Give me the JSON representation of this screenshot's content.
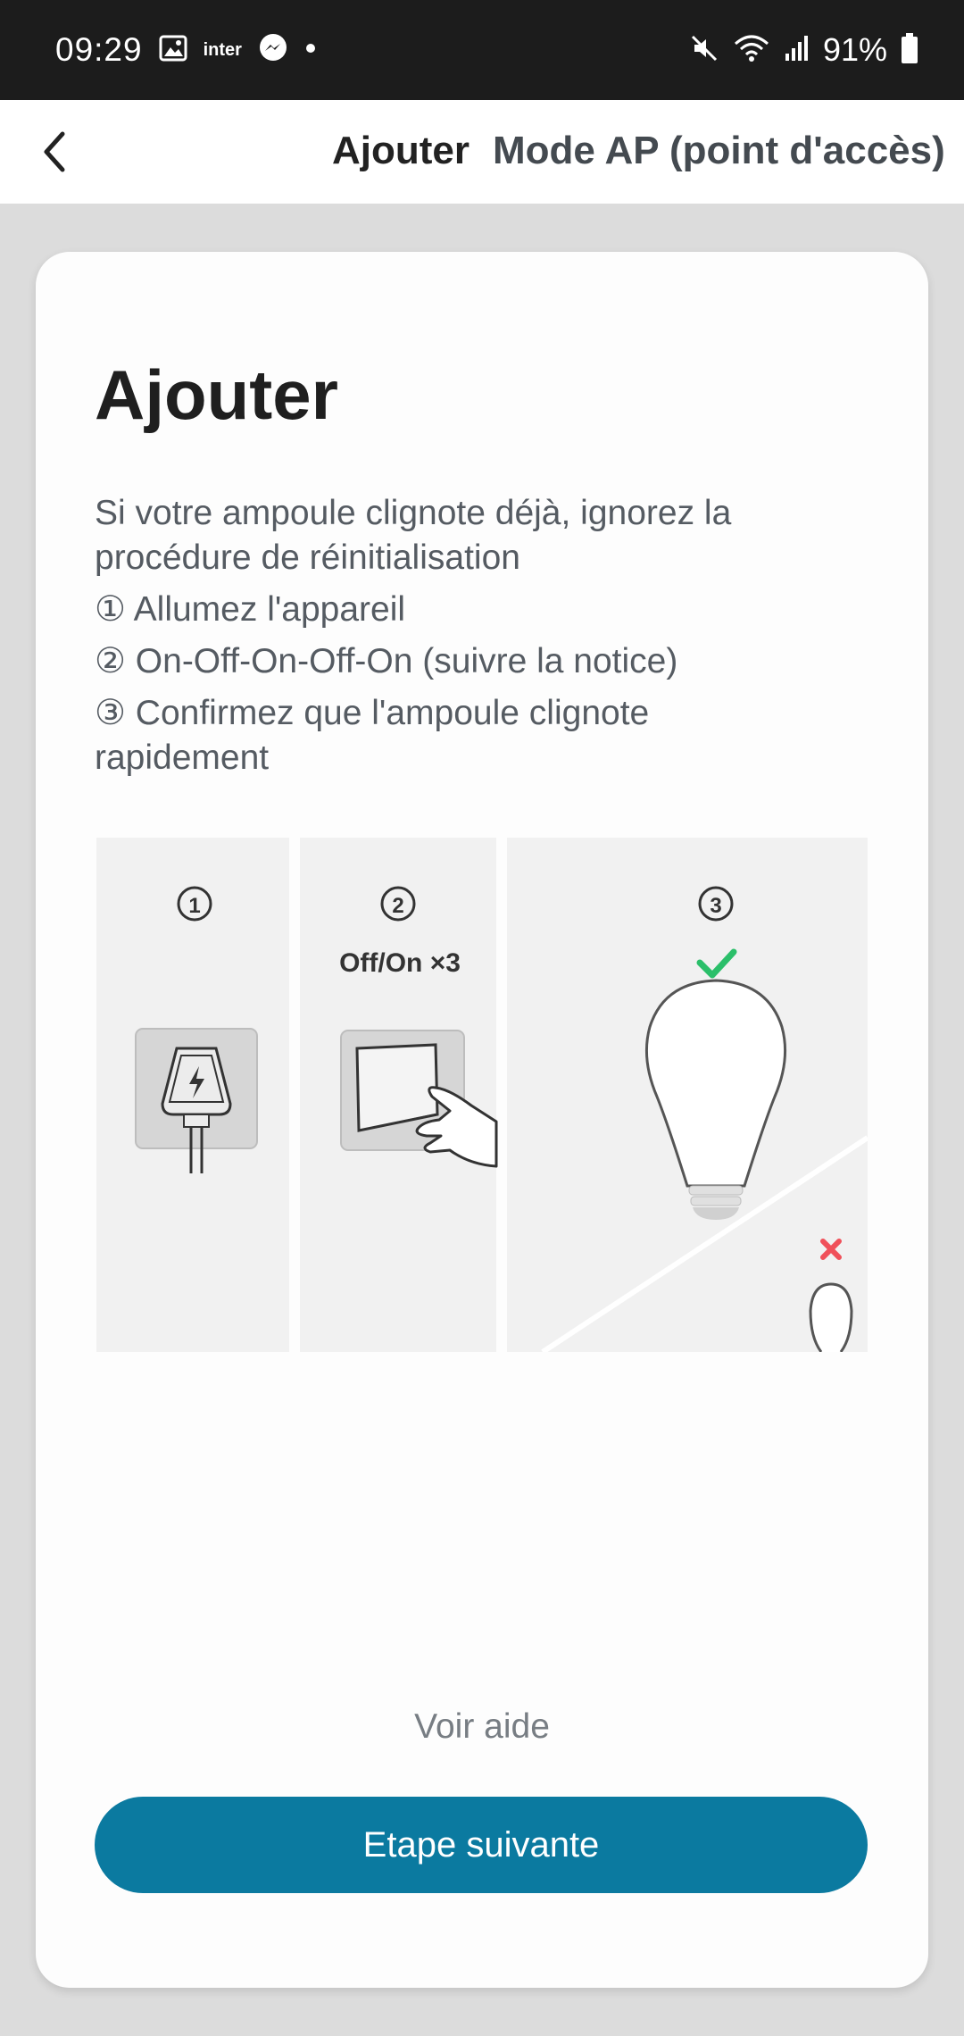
{
  "status_bar": {
    "time": "09:29",
    "carrier_label": "inter",
    "battery_percent": "91%"
  },
  "app_bar": {
    "title": "Ajouter",
    "subtitle": "Mode AP (point d'accès)"
  },
  "card": {
    "heading": "Ajouter",
    "instructions": {
      "line1": "Si votre ampoule clignote déjà, ignorez la",
      "line2": "procédure de réinitialisation",
      "step1": "① Allumez l'appareil",
      "step2": "② On-Off-On-Off-On (suivre la notice)",
      "step3a": "③ Confirmez que l'ampoule clignote",
      "step3b": "rapidement"
    },
    "illustration": {
      "panel1_number": "1",
      "panel2_number": "2",
      "panel2_caption": "Off/On ×3",
      "panel3_number": "3"
    },
    "help_link": "Voir aide",
    "next_button": "Etape suivante"
  },
  "colors": {
    "accent_button": "#0b7aa0",
    "check_green": "#2bbf6a",
    "cross_red": "#f0505a"
  }
}
